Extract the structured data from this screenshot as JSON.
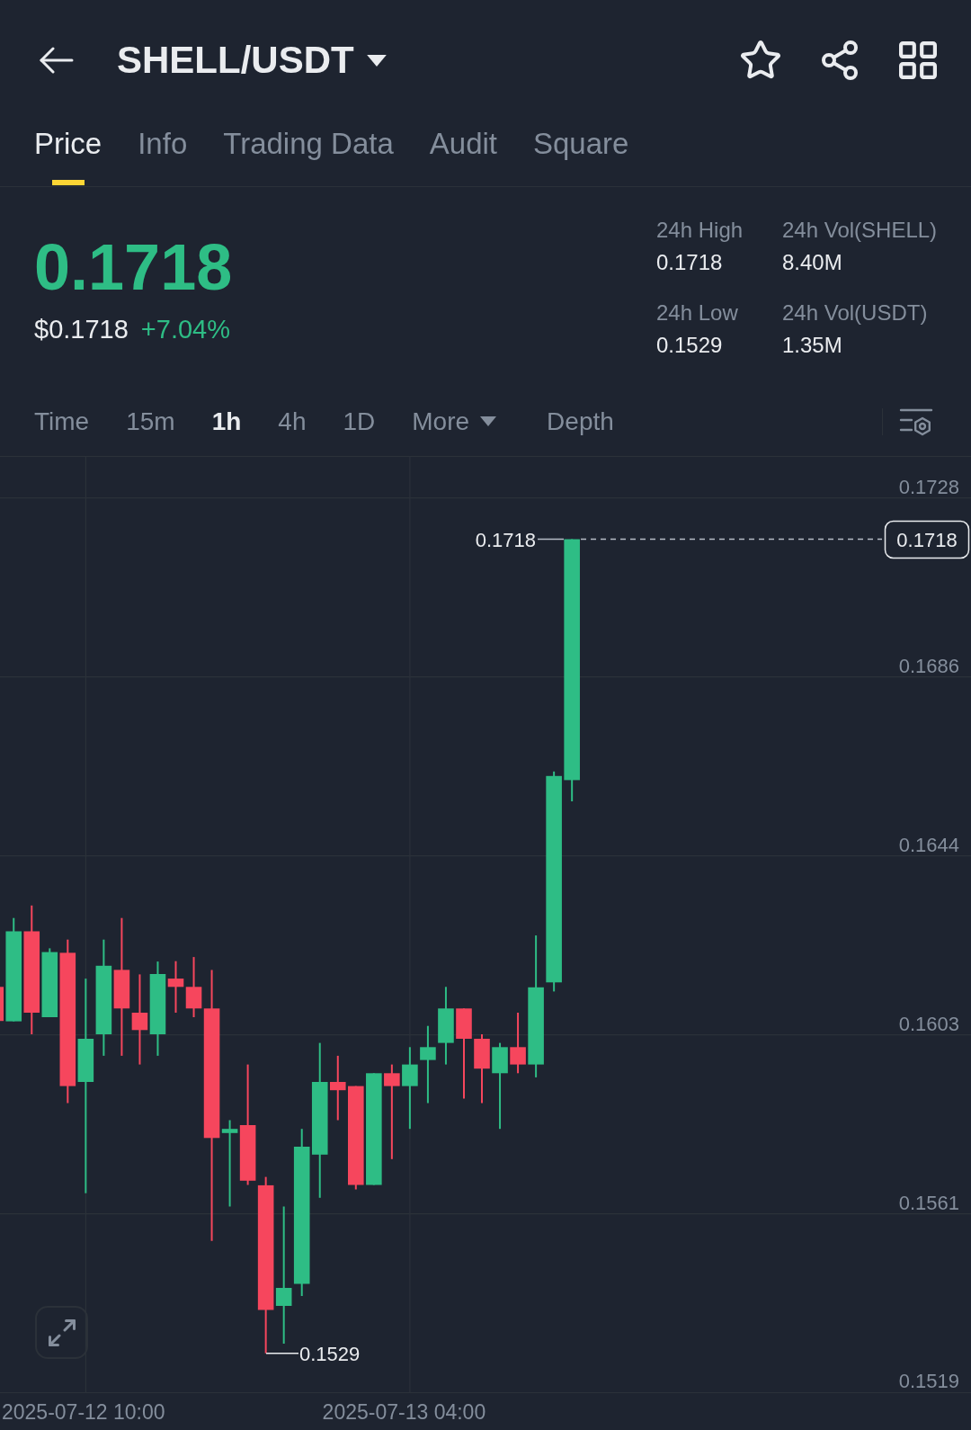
{
  "header": {
    "title": "SHELL/USDT"
  },
  "tabs": [
    {
      "label": "Price",
      "selected": true
    },
    {
      "label": "Info",
      "selected": false
    },
    {
      "label": "Trading Data",
      "selected": false
    },
    {
      "label": "Audit",
      "selected": false
    },
    {
      "label": "Square",
      "selected": false
    }
  ],
  "ticker": {
    "price": "0.1718",
    "fiat_price": "$0.1718",
    "change": "+7.04%",
    "rising": true
  },
  "stats": [
    {
      "label": "24h High",
      "value": "0.1718"
    },
    {
      "label": "24h Vol(SHELL)",
      "value": "8.40M"
    },
    {
      "label": "24h Low",
      "value": "0.1529"
    },
    {
      "label": "24h Vol(USDT)",
      "value": "1.35M"
    }
  ],
  "intervals": [
    {
      "label": "Time",
      "kind": "option",
      "selected": false
    },
    {
      "label": "15m",
      "kind": "option",
      "selected": false
    },
    {
      "label": "1h",
      "kind": "option",
      "selected": true
    },
    {
      "label": "4h",
      "kind": "option",
      "selected": false
    },
    {
      "label": "1D",
      "kind": "option",
      "selected": false
    },
    {
      "label": "More",
      "kind": "dropdown",
      "selected": false
    },
    {
      "label": "Depth",
      "kind": "view",
      "selected": false
    }
  ],
  "chart": {
    "price_axis": [
      "0.1728",
      "0.1686",
      "0.1644",
      "0.1603",
      "0.1561",
      "0.1519"
    ],
    "high_label": "0.1718",
    "low_label": "0.1529",
    "last_price": "0.1718",
    "time_axis": [
      "2025-07-12 10:00",
      "2025-07-13 04:00"
    ]
  }
}
